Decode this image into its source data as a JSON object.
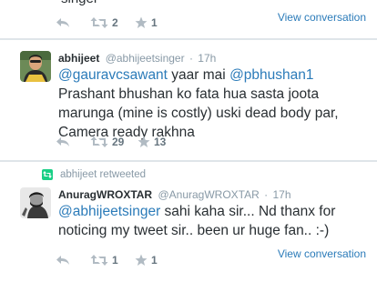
{
  "tweet1": {
    "cut_text": "singer",
    "retweet_count": "2",
    "favorite_count": "1",
    "view_conversation": "View conversation"
  },
  "tweet2": {
    "name": "abhijeet",
    "handle": "@abhijeetsinger",
    "dot": "·",
    "time": "17h",
    "mention1": "@gauravcsawant",
    "text1": " yaar mai ",
    "mention2": "@pbhushan1",
    "text2": " Prashant bhushan ko fata hua sasta joota marunga (mine is costly) uski dead body par, Camera ready rakhna",
    "retweet_count": "29",
    "favorite_count": "13"
  },
  "tweet3": {
    "retweeted_by": "abhijeet retweeted",
    "name": "AnuragWROXTAR",
    "handle": "@AnuragWROXTAR",
    "dot": "·",
    "time": "17h",
    "mention1": "@abhijeetsinger",
    "text1": " sahi kaha sir... Nd thanx for noticing my tweet sir.. been ur huge fan.. :-)",
    "retweet_count": "1",
    "favorite_count": "1",
    "view_conversation": "View conversation"
  },
  "icons": {
    "reply": "reply-icon",
    "retweet": "retweet-icon",
    "favorite": "star-icon",
    "retweeted": "retweet-badge-icon"
  },
  "colors": {
    "link": "#2b7bb9",
    "muted": "#8899a6",
    "retweet_green": "#19cf86"
  }
}
